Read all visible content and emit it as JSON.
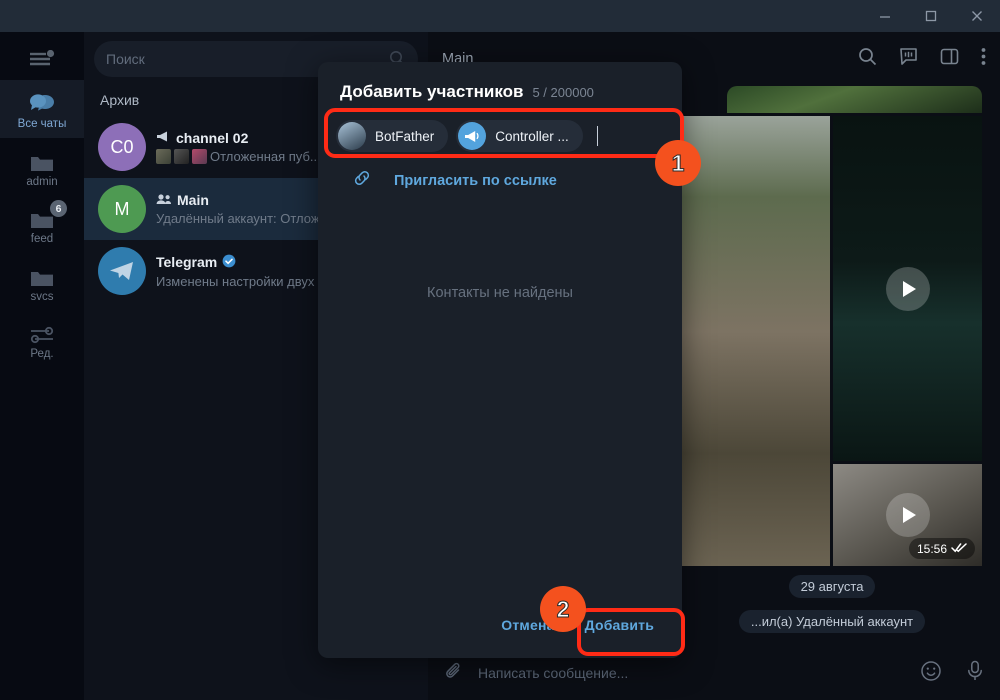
{
  "window": {
    "controls": [
      {
        "name": "minimize",
        "glyph": "minimize-icon"
      },
      {
        "name": "maximize",
        "glyph": "maximize-icon"
      },
      {
        "name": "close",
        "glyph": "close-icon"
      }
    ]
  },
  "rail": {
    "menu_icon": "hamburger-menu-icon",
    "items": [
      {
        "label": "Все чаты",
        "icon": "chats-bubble-icon",
        "active": true,
        "badge": ""
      },
      {
        "label": "admin",
        "icon": "folder-icon",
        "active": false,
        "badge": ""
      },
      {
        "label": "feed",
        "icon": "folder-icon",
        "active": false,
        "badge": "6"
      },
      {
        "label": "svcs",
        "icon": "folder-icon",
        "active": false,
        "badge": ""
      },
      {
        "label": "Ред.",
        "icon": "sliders-icon",
        "active": false,
        "badge": ""
      }
    ]
  },
  "search": {
    "placeholder": "Поиск",
    "icon": "search-icon"
  },
  "chatlist": {
    "section_label": "Архив",
    "rows": [
      {
        "title": "channel 02",
        "title_icon": "megaphone-icon",
        "subtitle": "Отложенная пуб...",
        "avatar_letters": "C0",
        "avatar_color": "#8d6fb8",
        "selected": false,
        "thumbs": 3
      },
      {
        "title": "Main",
        "title_icon": "group-icon",
        "subtitle": "Удалённый аккаунт: Отлож",
        "avatar_letters": "M",
        "avatar_color": "#4e9a52",
        "selected": true,
        "thumbs": 0
      },
      {
        "title": "Telegram",
        "title_icon": "verified-icon",
        "subtitle": "Изменены настройки двух",
        "avatar_letters": "",
        "avatar_color": "#2f7cae",
        "selected": false,
        "thumbs": 0
      }
    ]
  },
  "conversation": {
    "title": "Main",
    "head_icons": [
      "search-icon",
      "comments-icon",
      "right-panel-icon",
      "more-vertical-icon"
    ],
    "album": {
      "video_time": "15:56",
      "read_status": "double-check-icon"
    },
    "service_messages": [
      "29 августа",
      "...ил(а) Удалённый аккаунт"
    ],
    "composer": {
      "attach_icon": "paperclip-icon",
      "placeholder": "Написать сообщение...",
      "emoji_icon": "smile-icon",
      "mic_icon": "microphone-icon"
    }
  },
  "modal": {
    "title": "Добавить участников",
    "count": "5 / 200000",
    "chips": [
      {
        "name": "BotFather",
        "avatar": "botfather-photo-avatar"
      },
      {
        "name": "Controller ...",
        "avatar": "megaphone-avatar"
      }
    ],
    "invite": {
      "icon": "link-icon",
      "label": "Пригласить по ссылке"
    },
    "empty_text": "Контакты не найдены",
    "cancel_label": "Отмена",
    "confirm_label": "Добавить"
  },
  "annotations": [
    {
      "number": "1"
    },
    {
      "number": "2"
    }
  ],
  "colors": {
    "accent_blue": "#5fa8de",
    "highlight_red": "#ff2b16",
    "cue_orange": "#f4511e"
  }
}
